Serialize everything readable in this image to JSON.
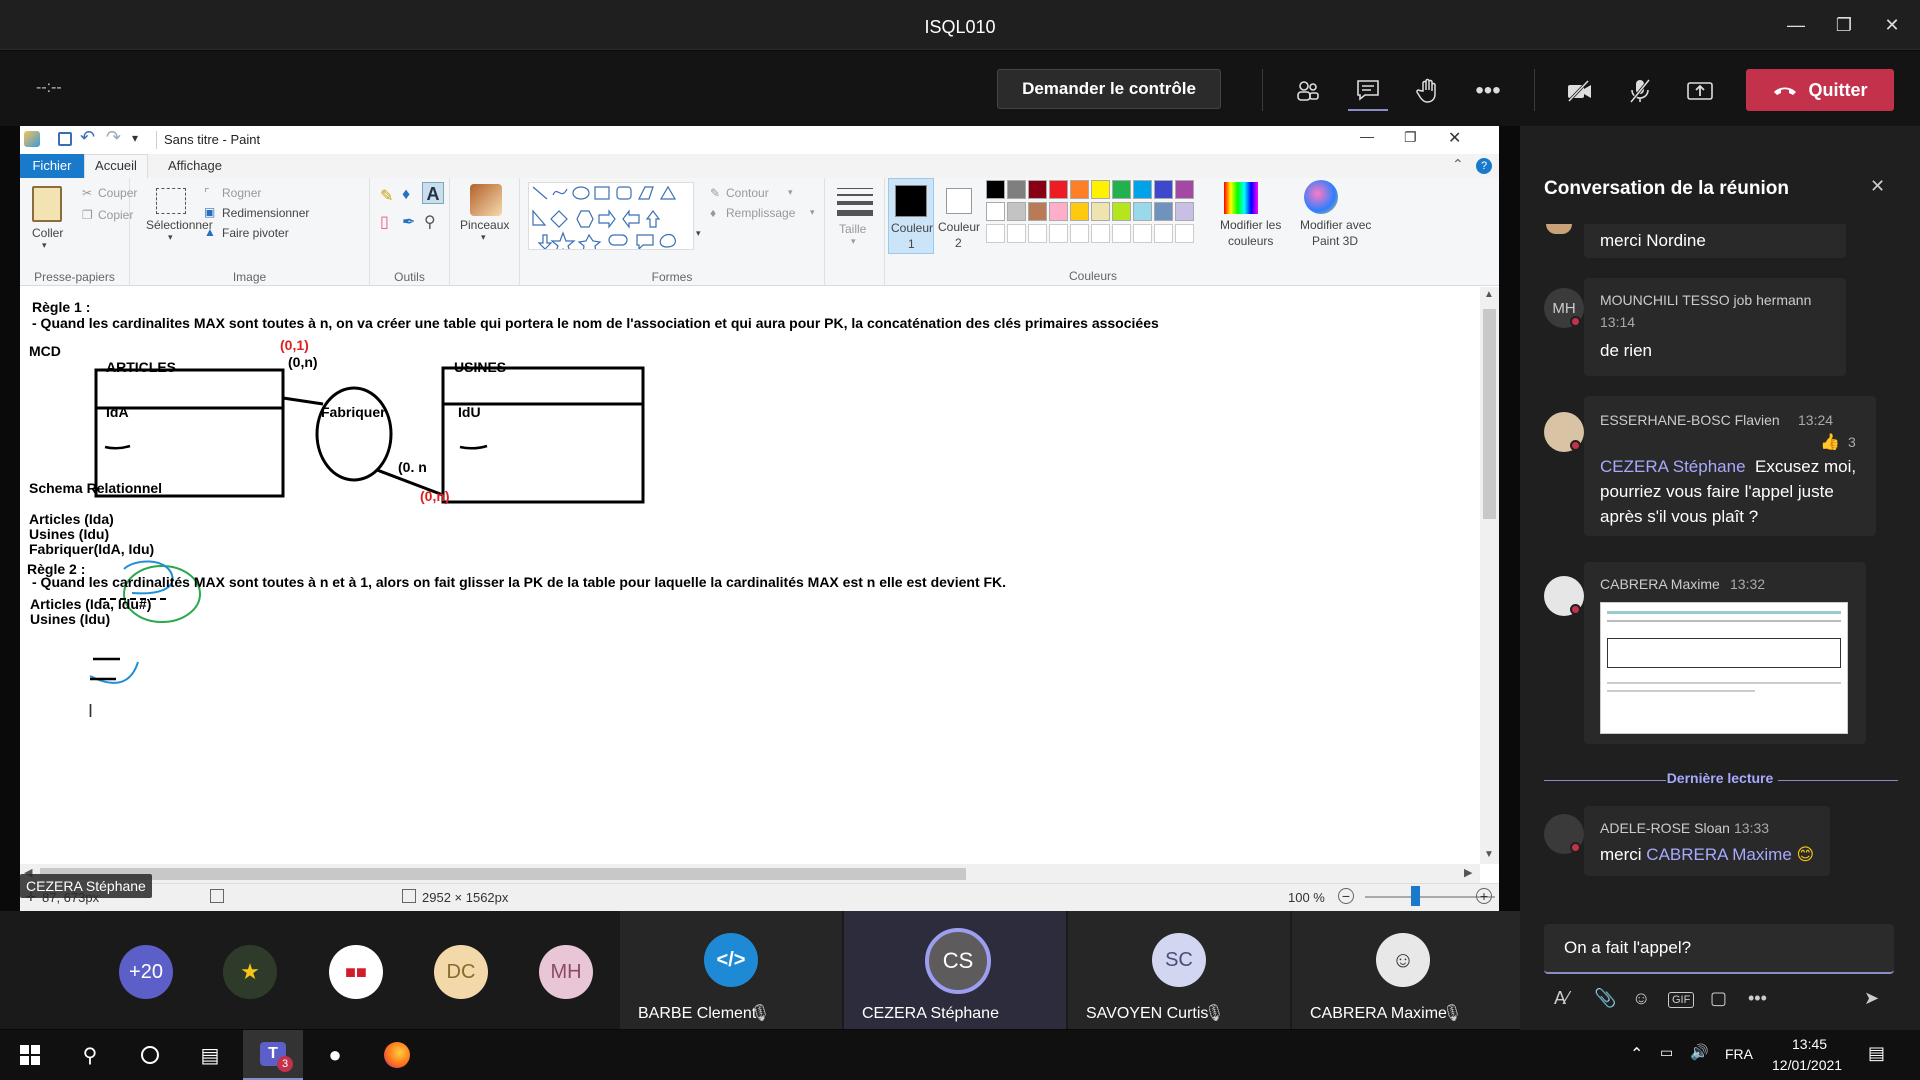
{
  "window": {
    "title": "ISQL010"
  },
  "meeting": {
    "timer": "--:--",
    "request_control": "Demander le contrôle",
    "quit_label": "Quitter"
  },
  "paint": {
    "title": "Sans titre - Paint",
    "tabs": [
      "Fichier",
      "Accueil",
      "Affichage"
    ],
    "ribbon": {
      "clipboard": {
        "paste": "Coller",
        "cut": "Couper",
        "copy": "Copier",
        "group": "Presse-papiers"
      },
      "image": {
        "select": "Sélectionner",
        "crop": "Rogner",
        "resize": "Redimensionner",
        "rotate": "Faire pivoter",
        "group": "Image"
      },
      "tools": {
        "group": "Outils"
      },
      "brushes": {
        "label": "Pinceaux"
      },
      "shapes": {
        "outline": "Contour",
        "fill": "Remplissage",
        "group": "Formes"
      },
      "size": {
        "label": "Taille"
      },
      "color1": {
        "label1": "Couleur",
        "label2": "1"
      },
      "color2": {
        "label1": "Couleur",
        "label2": "2"
      },
      "colors": {
        "group": "Couleurs",
        "edit1": "Modifier les",
        "edit2": "couleurs",
        "paint3d1": "Modifier avec",
        "paint3d2": "Paint 3D"
      },
      "palette": [
        "#000000",
        "#7f7f7f",
        "#880015",
        "#ed1c24",
        "#ff7f27",
        "#fff200",
        "#22b14c",
        "#00a2e8",
        "#3f48cc",
        "#a349a4",
        "#ffffff",
        "#c3c3c3",
        "#b97a57",
        "#ffaec9",
        "#ffc90e",
        "#efe4b0",
        "#b5e61d",
        "#99d9ea",
        "#7092be",
        "#c8bfe7"
      ]
    },
    "canvas": {
      "rule1_title": "Règle 1 :",
      "rule1_text": "- Quand les cardinalites MAX sont toutes à n, on va créer une table qui portera le nom de l'association et qui aura pour PK, la concaténation des clés primaires associées",
      "mcd": "MCD",
      "card_red_top": "(0,1)",
      "card_top": "(0,n)",
      "articles": "ARTICLES",
      "ida": "IdA",
      "fabriquer": "Fabriquer",
      "usines": "USINES",
      "idu": "IdU",
      "card_bottom": "(0. n",
      "card_red_bottom": "(0,n)",
      "schema": "Schema Relationnel",
      "s1": "Articles (Ida)",
      "s2": "Usines (Idu)",
      "s3": "Fabriquer(IdA, Idu)",
      "rule2_title": "Règle 2 :",
      "rule2_text": "- Quand les cardinalités MAX sont toutes à n et à 1, alors on fait glisser la PK de la table pour laquelle la cardinalités MAX est n elle est devient FK.",
      "s4": "Articles (Ida, Idu#)",
      "s5": "Usines (Idu)"
    },
    "status": {
      "coords": "87, 673px",
      "dims": "2952 × 1562px",
      "zoom": "100 %"
    }
  },
  "presenter_label": "CEZERA Stéphane",
  "chat": {
    "title": "Conversation de la réunion",
    "messages": [
      {
        "text": "merci Nordine"
      },
      {
        "initials": "MH",
        "name": "MOUNCHILI TESSO job hermann",
        "time": "13:14",
        "text": "de rien"
      },
      {
        "name": "ESSERHANE-BOSC Flavien",
        "time": "13:24",
        "reaction": "3",
        "mention": "CEZERA Stéphane",
        "line1": "Excusez moi,",
        "line2": "pourriez vous faire l'appel juste",
        "line3": "après s'il vous plaît ?"
      },
      {
        "name": "CABRERA Maxime",
        "time": "13:32"
      },
      {
        "name": "ADELE-ROSE Sloan",
        "time": "13:33",
        "prefix": "merci",
        "mention": "CABRERA Maxime"
      }
    ],
    "last_read": "Dernière lecture",
    "compose_value": "On a fait l'appel?"
  },
  "participants": {
    "overflow": "+20",
    "avatars": [
      "DC",
      "MH"
    ],
    "tiles": [
      {
        "name": "BARBE Clement"
      },
      {
        "initials": "CS",
        "name": "CEZERA Stéphane"
      },
      {
        "initials": "SC",
        "name": "SAVOYEN Curtis"
      },
      {
        "name": "CABRERA Maxime"
      }
    ]
  },
  "taskbar": {
    "lang": "FRA",
    "time": "13:45",
    "date": "12/01/2021",
    "teams_badge": "3"
  },
  "colors": {
    "quit": "#c4314b",
    "accent": "#6264a7",
    "mention": "#a7a9ff"
  }
}
